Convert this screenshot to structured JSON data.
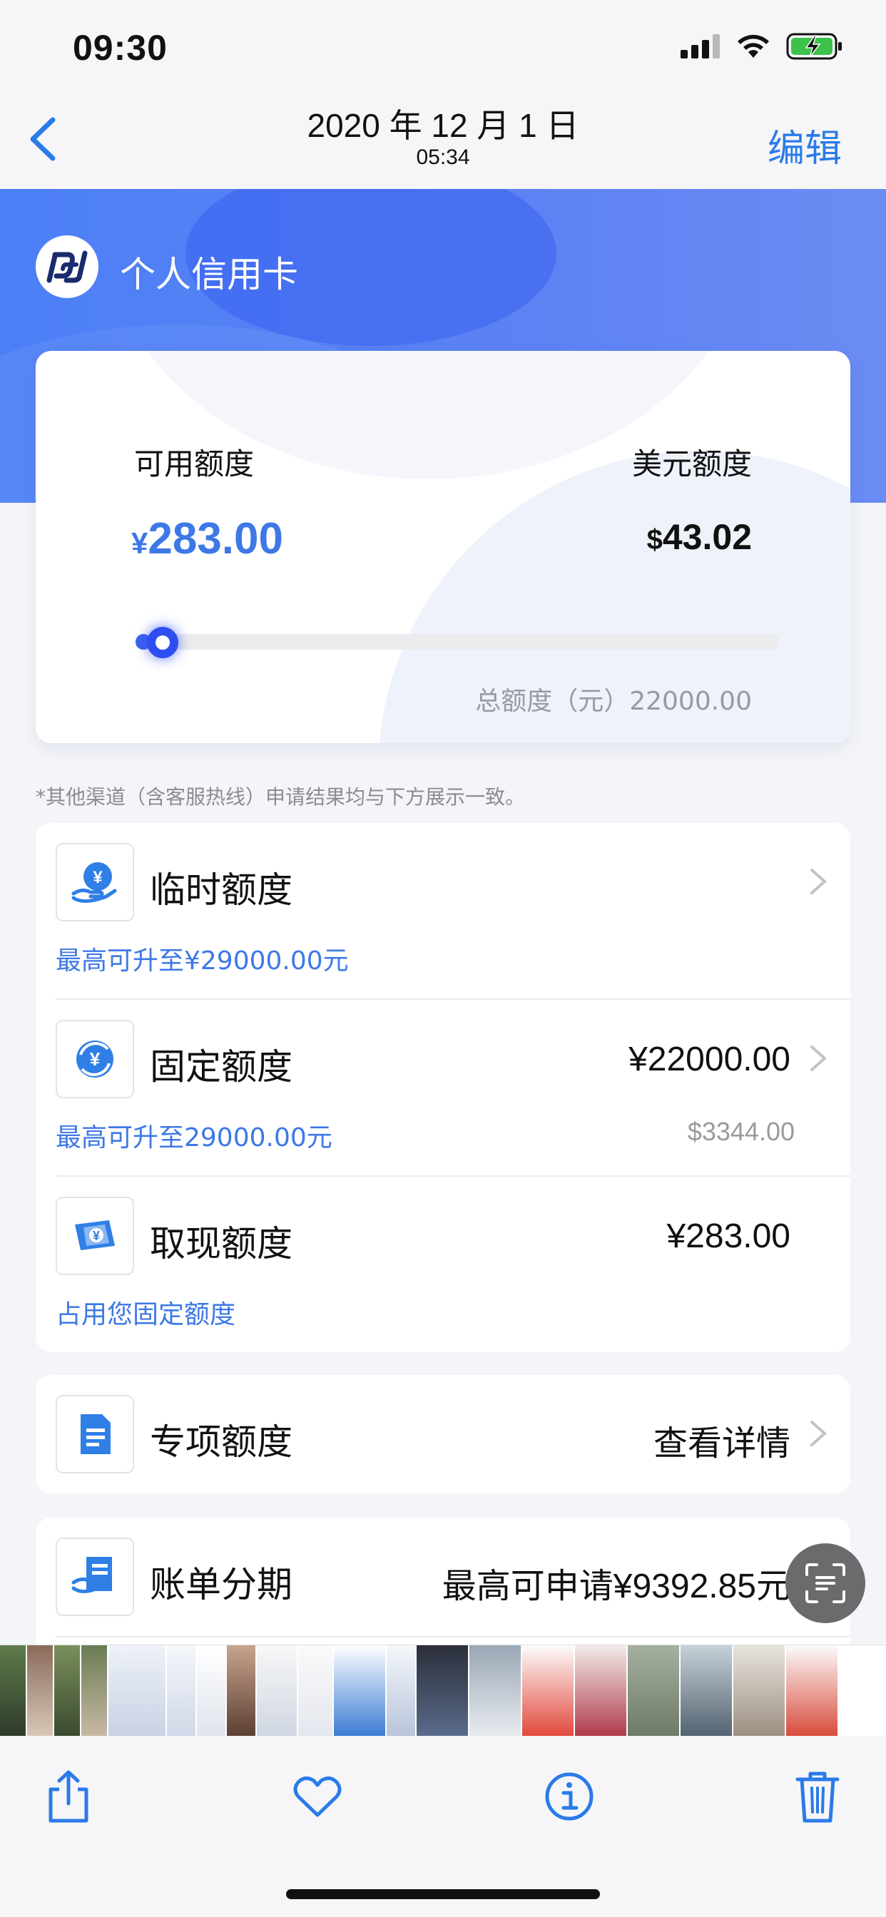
{
  "status_bar": {
    "time": "09:30"
  },
  "nav": {
    "title": "2020 年 12 月 1 日",
    "subtitle": "05:34",
    "edit_label": "编辑"
  },
  "bank": {
    "name": "个人信用卡"
  },
  "quota": {
    "available_label": "可用额度",
    "available_currency": "¥",
    "available_value": "283.00",
    "usd_label": "美元额度",
    "usd_currency": "$",
    "usd_value": "43.02",
    "usage_fraction": 0.013,
    "total_label": "总额度（元）22000.00"
  },
  "notice": "*其他渠道（含客服热线）申请结果均与下方展示一致。",
  "limits": [
    {
      "title": "临时额度",
      "value": "",
      "sub": "最高可升至¥29000.00元",
      "sub_right": "",
      "icon": "hand-yen-icon"
    },
    {
      "title": "固定额度",
      "value": "¥22000.00",
      "sub": "最高可升至29000.00元",
      "sub_right": "$3344.00",
      "icon": "yen-exchange-icon"
    },
    {
      "title": "取现额度",
      "value": "¥283.00",
      "sub": "占用您固定额度",
      "sub_right": "",
      "icon": "cash-icon"
    }
  ],
  "special": {
    "title": "专项额度",
    "value": "查看详情",
    "icon": "document-icon"
  },
  "installment": {
    "title": "账单分期",
    "value": "最高可申请¥9392.85元",
    "icon": "bill-icon"
  },
  "colors": {
    "accent": "#3d78e6",
    "hero": "#5c82f3",
    "ios_blue": "#2a7be9"
  },
  "toolbar": {
    "share": "share-icon",
    "favorite": "heart-icon",
    "info": "info-icon",
    "delete": "trash-icon"
  }
}
